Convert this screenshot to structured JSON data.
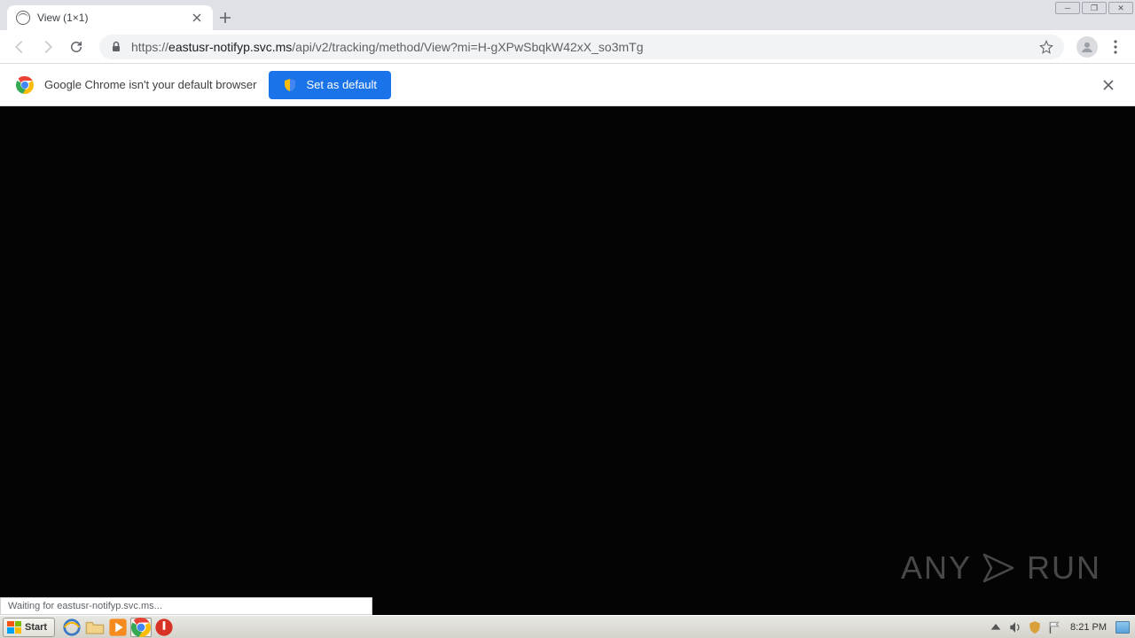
{
  "tab": {
    "title": "View (1×1)"
  },
  "url": {
    "scheme": "https://",
    "host": "eastusr-notifyp.svc.ms",
    "path": "/api/v2/tracking/method/View?mi=H-gXPwSbqkW42xX_so3mTg"
  },
  "infobar": {
    "message": "Google Chrome isn't your default browser",
    "button_label": "Set as default"
  },
  "status": {
    "text": "Waiting for eastusr-notifyp.svc.ms..."
  },
  "watermark": {
    "left": "ANY",
    "right": "RUN"
  },
  "taskbar": {
    "start_label": "Start",
    "clock": "8:21 PM"
  }
}
